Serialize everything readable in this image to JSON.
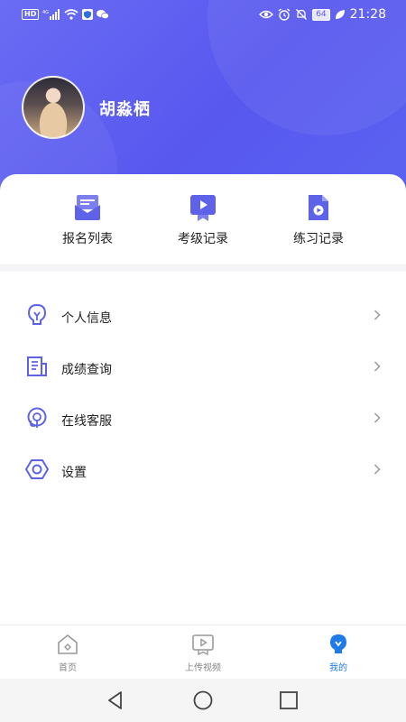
{
  "statusbar": {
    "hd": "HD",
    "signal_tag": "4G",
    "battery": "64",
    "time": "21:28"
  },
  "profile": {
    "name": "胡淼栖"
  },
  "quick_actions": [
    {
      "label": "报名列表",
      "icon": "envelope-icon"
    },
    {
      "label": "考级记录",
      "icon": "video-badge-icon"
    },
    {
      "label": "练习记录",
      "icon": "document-play-icon"
    }
  ],
  "menu": [
    {
      "label": "个人信息",
      "icon": "lightbulb-icon"
    },
    {
      "label": "成绩查询",
      "icon": "document-list-icon"
    },
    {
      "label": "在线客服",
      "icon": "headset-icon"
    },
    {
      "label": "设置",
      "icon": "hexagon-gear-icon"
    }
  ],
  "tabbar": [
    {
      "label": "首页",
      "icon": "home-icon",
      "active": false
    },
    {
      "label": "上传视频",
      "icon": "upload-video-icon",
      "active": false
    },
    {
      "label": "我的",
      "icon": "profile-icon",
      "active": true
    }
  ],
  "colors": {
    "header_gradient_start": "#6a6cf4",
    "header_gradient_end": "#5858ef",
    "icon_accent": "#5d62e8",
    "active_tab": "#1f7be8"
  }
}
